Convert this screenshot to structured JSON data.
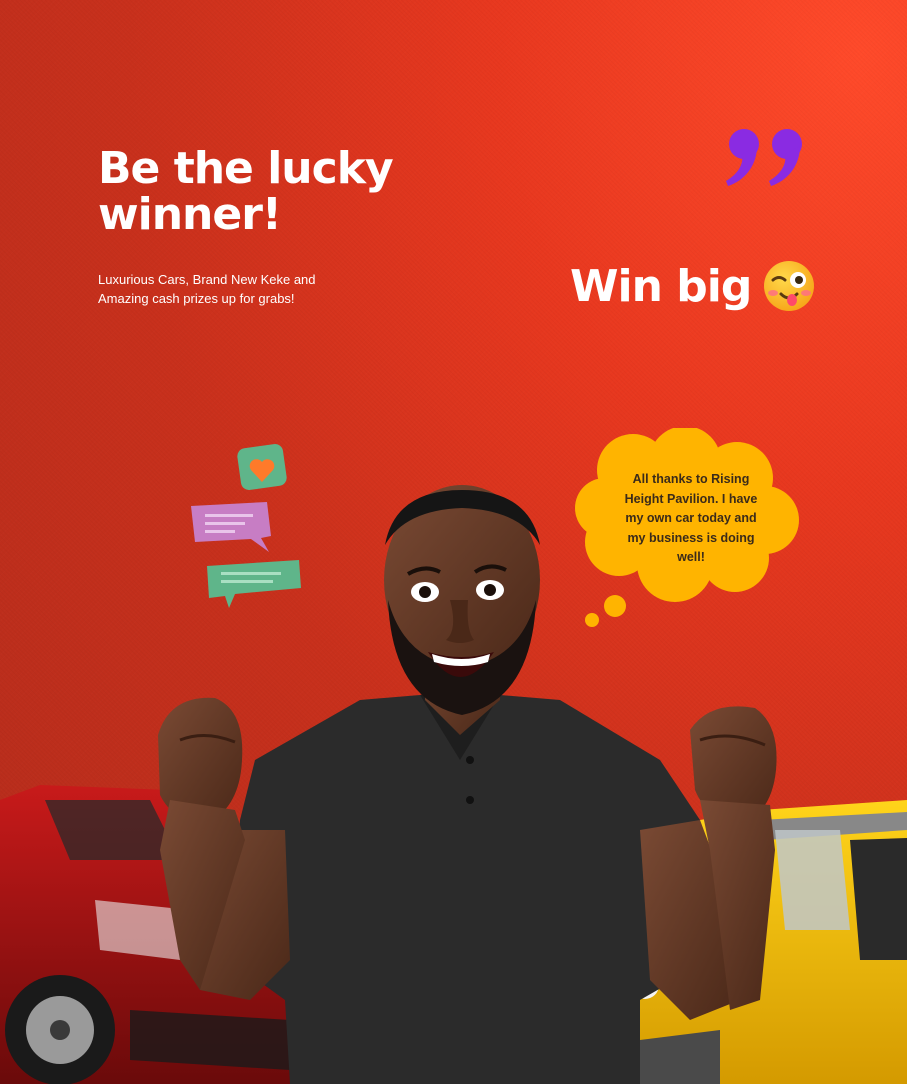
{
  "headline": "Be the lucky winner!",
  "subtext": "Luxurious Cars, Brand New Keke and Amazing cash prizes up for grabs!",
  "win_text": "Win big",
  "thought_bubble": "All thanks to Rising Height Pavilion. I have my own car today and my business is doing well!",
  "colors": {
    "background": "#c8301c",
    "accent_yellow": "#ffb400",
    "quote_purple": "#8a2be2",
    "chat_pink": "#c77dc4",
    "chat_green": "#5fb58a"
  },
  "icons": [
    "quote-mark-icon",
    "winking-emoji-icon",
    "heart-chat-icon",
    "message-bubble-icon"
  ]
}
